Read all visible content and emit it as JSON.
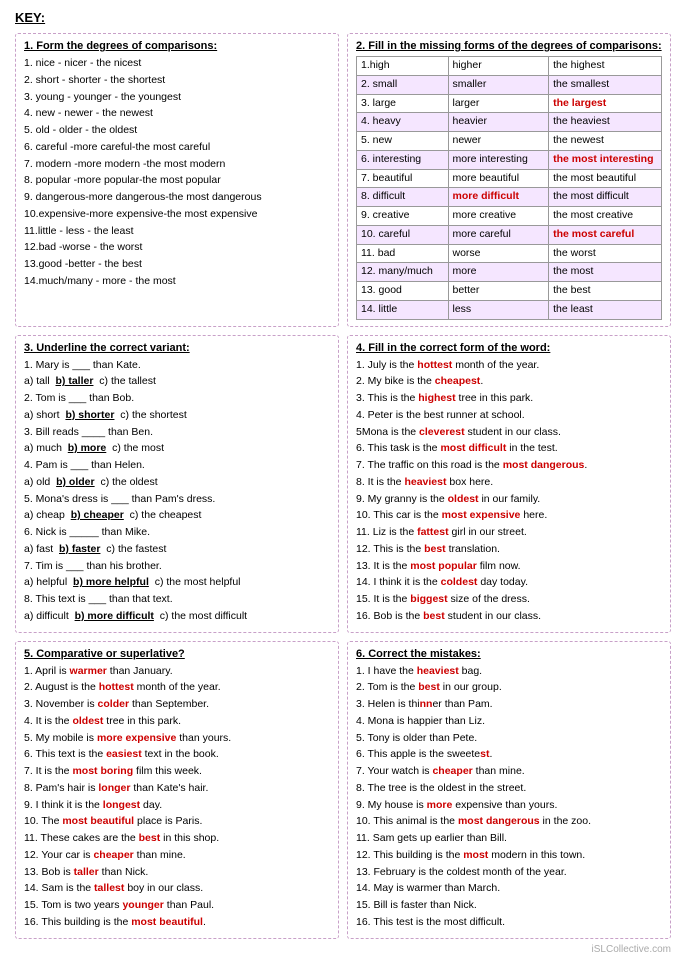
{
  "title": "KEY:",
  "section1": {
    "title": "1. Form the degrees of comparisons:",
    "items": [
      "1. nice - nicer - the nicest",
      "2. short - shorter - the shortest",
      "3. young - younger - the youngest",
      "4. new - newer - the newest",
      "5. old - older - the oldest",
      "6. careful -more careful-the most careful",
      "7. modern -more modern -the most modern",
      "8. popular -more popular-the most popular",
      "9. dangerous-more dangerous-the most dangerous",
      "10.expensive-more expensive-the most expensive",
      "11.little - less - the least",
      "12.bad -worse - the worst",
      "13.good -better - the best",
      "14.much/many - more - the most"
    ]
  },
  "section2": {
    "title": "2. Fill in the missing forms of the degrees of comparisons:",
    "rows": [
      {
        "base": "1.high",
        "comp": "higher",
        "super": "the highest",
        "highlight": ""
      },
      {
        "base": "2. small",
        "comp": "smaller",
        "super": "the smallest",
        "highlight": ""
      },
      {
        "base": "3. large",
        "comp": "larger",
        "super": "the largest",
        "highlight": "super"
      },
      {
        "base": "4. heavy",
        "comp": "heavier",
        "super": "the heaviest",
        "highlight": ""
      },
      {
        "base": "5. new",
        "comp": "newer",
        "super": "the newest",
        "highlight": ""
      },
      {
        "base": "6. interesting",
        "comp": "more interesting",
        "super": "the most interesting",
        "highlight": "super"
      },
      {
        "base": "7. beautiful",
        "comp": "more beautiful",
        "super": "the most beautiful",
        "highlight": ""
      },
      {
        "base": "8. difficult",
        "comp": "more difficult",
        "super": "the most difficult",
        "highlight": "comp"
      },
      {
        "base": "9. creative",
        "comp": "more creative",
        "super": "the most creative",
        "highlight": ""
      },
      {
        "base": "10. careful",
        "comp": "more careful",
        "super": "the most careful",
        "highlight": "super"
      },
      {
        "base": "11. bad",
        "comp": "worse",
        "super": "the worst",
        "highlight": ""
      },
      {
        "base": "12. many/much",
        "comp": "more",
        "super": "the most",
        "highlight": ""
      },
      {
        "base": "13. good",
        "comp": "better",
        "super": "the best",
        "highlight": ""
      },
      {
        "base": "14. little",
        "comp": "less",
        "super": "the least",
        "highlight": ""
      }
    ]
  },
  "section3": {
    "title": "3. Underline the correct variant:",
    "items": [
      {
        "text": "1. Mary is ___ than Kate.",
        "parts": [
          "a) tall",
          "b) taller",
          "c) the tallest"
        ],
        "answer": 1
      },
      {
        "text": "2. Tom is ___ than Bob.",
        "parts": [
          "a) short",
          "b) shorter",
          "c) the shortest"
        ],
        "answer": 1
      },
      {
        "text": "3. Bill reads ____ than Ben.",
        "parts": [
          "a) much",
          "b) more",
          "c) the most"
        ],
        "answer": 1
      },
      {
        "text": "4. Pam is ___ than Helen.",
        "parts": [
          "a) old",
          "b) older",
          "c) the oldest"
        ],
        "answer": 1
      },
      {
        "text": "5. Mona's dress is ___ than Pam's dress.",
        "parts": [
          "a) cheap",
          "b) cheaper",
          "c) the cheapest"
        ],
        "answer": 1
      },
      {
        "text": "6. Nick is _____ than Mike.",
        "parts": [
          "a) fast",
          "b) faster",
          "c) the fastest"
        ],
        "answer": 1
      },
      {
        "text": "7. Tim is ___ than his brother.",
        "parts": [
          "a) helpful",
          "b) more helpful",
          "c) the most helpful"
        ],
        "answer": 1
      },
      {
        "text": "8. This text is ___ than that text.",
        "parts": [
          "a) difficult",
          "b) more difficult",
          "c) the most difficult"
        ],
        "answer": 1
      }
    ]
  },
  "section4": {
    "title": "4. Fill in the correct form of the word:",
    "items": [
      {
        "pre": "1. July is the ",
        "answer": "hottest",
        "post": " month of the year."
      },
      {
        "pre": "2. My bike is the ",
        "answer": "cheapest",
        "post": "."
      },
      {
        "pre": "3. This is the ",
        "answer": "highest",
        "post": " tree in this park."
      },
      {
        "pre": "4. Peter is the best runner at school."
      },
      {
        "pre": "5Mona is the ",
        "answer": "cleverest",
        "post": " student in our class."
      },
      {
        "pre": "6. This task is the ",
        "answer": "most difficult",
        "post": " in the test."
      },
      {
        "pre": "7. The traffic on this road is the ",
        "answer": "most dangerous",
        "post": "."
      },
      {
        "pre": "8. It is the ",
        "answer": "heaviest",
        "post": " box here."
      },
      {
        "pre": "9. My granny is the ",
        "answer": "oldest",
        "post": " in our family."
      },
      {
        "pre": "10. This car is the ",
        "answer": "most expensive",
        "post": " here."
      },
      {
        "pre": "11. Liz is the ",
        "answer": "fattest",
        "post": " girl in our street."
      },
      {
        "pre": "12. This is the ",
        "answer": "best",
        "post": " translation."
      },
      {
        "pre": "13. It is the ",
        "answer": "most popular",
        "post": " film now."
      },
      {
        "pre": "14. I think it is the ",
        "answer": "coldest",
        "post": " day today."
      },
      {
        "pre": "15. It is the ",
        "answer": "biggest",
        "post": " size of the dress."
      },
      {
        "pre": "16. Bob is the ",
        "answer": "best",
        "post": " student in our class."
      }
    ]
  },
  "section5": {
    "title": "5. Comparative or superlative?",
    "items": [
      {
        "pre": "1. April is ",
        "answer": "warmer",
        "post": " than January."
      },
      {
        "pre": "2. August is the ",
        "answer": "hottest",
        "post": " month of the year."
      },
      {
        "pre": "3. November is ",
        "answer": "colder",
        "post": " than September."
      },
      {
        "pre": "4. It is the ",
        "answer": "oldest",
        "post": " tree in this park."
      },
      {
        "pre": "5. My mobile is ",
        "answer": "more expensive",
        "post": " than yours."
      },
      {
        "pre": "6. This text is the ",
        "answer": "easiest",
        "post": " text in the book."
      },
      {
        "pre": "7. It is the ",
        "answer": "most boring",
        "post": " film this week."
      },
      {
        "pre": "8. Pam's hair is ",
        "answer": "longer",
        "post": " than Kate's hair."
      },
      {
        "pre": "9. I think it is the ",
        "answer": "longest",
        "post": " day."
      },
      {
        "pre": "10. The ",
        "answer": "most beautiful",
        "post": " place is Paris."
      },
      {
        "pre": "11. These cakes are the ",
        "answer": "best",
        "post": " in this shop."
      },
      {
        "pre": "12. Your car is ",
        "answer": "cheaper",
        "post": " than mine."
      },
      {
        "pre": "13. Bob is ",
        "answer": "taller",
        "post": " than Nick."
      },
      {
        "pre": "14. Sam is the ",
        "answer": "tallest",
        "post": " boy in our class."
      },
      {
        "pre": "15. Tom is two years ",
        "answer": "younger",
        "post": " than Paul."
      },
      {
        "pre": "16. This building is the ",
        "answer": "most beautiful",
        "post": "."
      }
    ]
  },
  "section6": {
    "title": "6. Correct the mistakes:",
    "items": [
      {
        "pre": "1. I have the ",
        "answer": "heaviest",
        "post": " bag."
      },
      {
        "pre": "2. Tom is the ",
        "answer": "best",
        "post": " in our group."
      },
      {
        "pre": "3. Helen is thi",
        "answer": "nn",
        "post": "er than Pam."
      },
      {
        "pre": "4. Mona is happier than Liz."
      },
      {
        "pre": "5. Tony is older than Pete."
      },
      {
        "pre": "6. This apple is the sweete",
        "answer": "st",
        "post": "."
      },
      {
        "pre": "7. Your watch is ",
        "answer": "cheaper",
        "post": " than mine."
      },
      {
        "pre": "8. The tree is the oldest in the street."
      },
      {
        "pre": "9. My house is ",
        "answer": "more",
        "post": " expensive than yours."
      },
      {
        "pre": "10. This animal is the ",
        "answer": "most dangerous",
        "post": " in the zoo."
      },
      {
        "pre": "11. Sam gets up earlier than Bill."
      },
      {
        "pre": "12. This building is the ",
        "answer": "most",
        "post": " modern in this town."
      },
      {
        "pre": "13. February is the coldest month of the year."
      },
      {
        "pre": "14. May is warmer than March."
      },
      {
        "pre": "15. Bill is faster than Nick."
      },
      {
        "pre": "16. This test is the most difficult."
      }
    ]
  },
  "watermark": "iSLCollective.com"
}
